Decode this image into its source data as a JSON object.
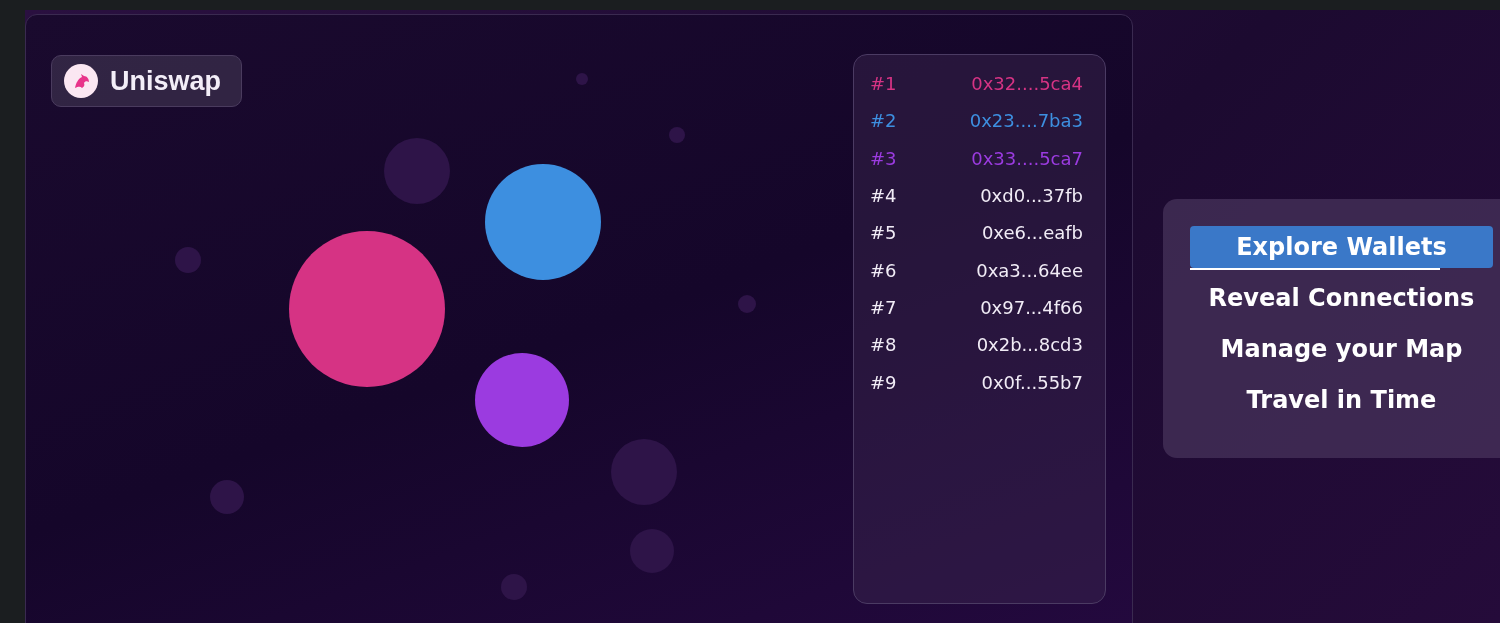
{
  "token": {
    "name": "Uniswap"
  },
  "wallets": [
    {
      "rank": "#1",
      "address": "0x32....5ca4",
      "color": "#d63384"
    },
    {
      "rank": "#2",
      "address": "0x23....7ba3",
      "color": "#3d8fe0"
    },
    {
      "rank": "#3",
      "address": "0x33....5ca7",
      "color": "#9b3be0"
    },
    {
      "rank": "#4",
      "address": "0xd0...37fb"
    },
    {
      "rank": "#5",
      "address": "0xe6...eafb"
    },
    {
      "rank": "#6",
      "address": "0xa3...64ee"
    },
    {
      "rank": "#7",
      "address": "0x97...4f66"
    },
    {
      "rank": "#8",
      "address": "0x2b...8cd3"
    },
    {
      "rank": "#9",
      "address": "0x0f...55b7"
    }
  ],
  "menu": [
    {
      "label": "Explore Wallets",
      "selected": true
    },
    {
      "label": "Reveal Connections",
      "selected": false
    },
    {
      "label": "Manage your Map",
      "selected": false
    },
    {
      "label": "Travel in Time",
      "selected": false
    }
  ]
}
